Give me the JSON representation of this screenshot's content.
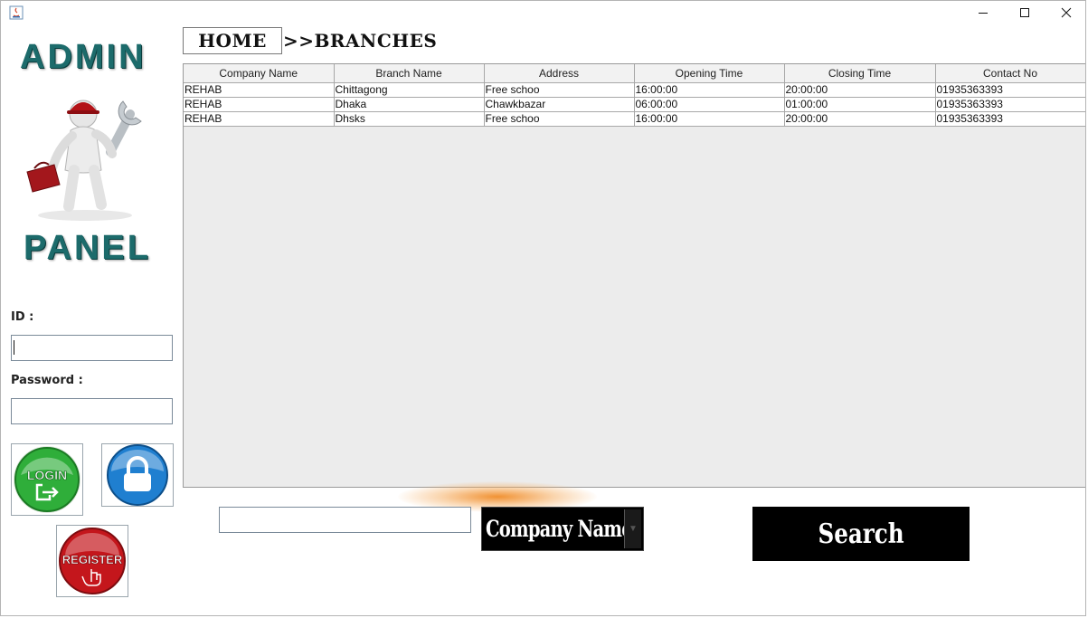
{
  "window": {
    "minimize_icon": "minimize-icon",
    "maximize_icon": "maximize-icon",
    "close_icon": "close-icon"
  },
  "sidebar": {
    "logo_top": "ADMIN",
    "logo_bottom": "PANEL",
    "id_label": "ID :",
    "id_value": "",
    "password_label": "Password :",
    "password_value": "",
    "login_label": "LOGIN",
    "register_label": "REGISTER"
  },
  "breadcrumb": {
    "home": "HOME",
    "current": ">>BRANCHES"
  },
  "table": {
    "columns": [
      "Company Name",
      "Branch Name",
      "Address",
      "Opening Time",
      "Closing Time",
      "Contact No"
    ],
    "rows": [
      [
        "REHAB",
        "Chittagong",
        "Free schoo",
        "16:00:00",
        "20:00:00",
        "01935363393"
      ],
      [
        "REHAB",
        "Dhaka",
        "Chawkbazar",
        "06:00:00",
        "01:00:00",
        "01935363393"
      ],
      [
        "REHAB",
        "Dhsks",
        "Free schoo",
        "16:00:00",
        "20:00:00",
        "01935363393"
      ]
    ]
  },
  "search": {
    "input_value": "",
    "filter_selected": "Company Name",
    "button_label": "Search"
  },
  "colors": {
    "logo_teal": "#1c6b6b",
    "login_green": "#2fae3a",
    "lock_blue": "#1f7fd0",
    "register_red": "#c4161c",
    "glow_orange": "#f08c28"
  }
}
